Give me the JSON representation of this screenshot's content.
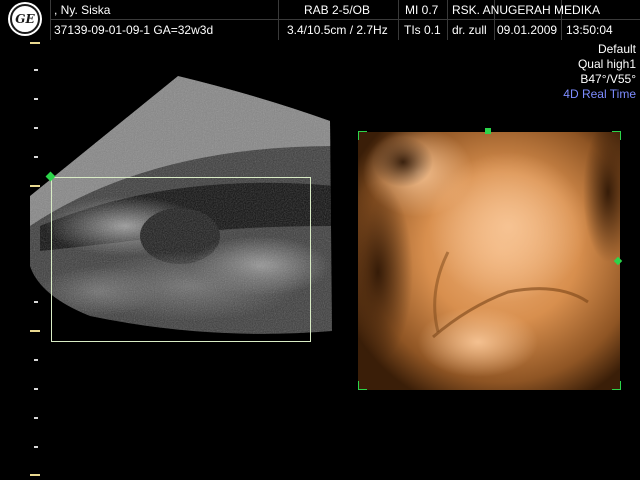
{
  "header": {
    "patient_name": ", Ny. Siska",
    "patient_id_ga": "37139-09-01-09-1  GA=32w3d",
    "probe": "RAB 2-5/OB",
    "depth_freq": "3.4/10.5cm / 2.7Hz",
    "mi": "MI  0.7",
    "tis": "TIs  0.1",
    "hospital": "RSK. ANUGERAH MEDIKA",
    "doctor": "dr. zull",
    "date": "09.01.2009",
    "time": "13:50:04"
  },
  "info_panel": {
    "preset": "Default",
    "quality": "Qual high1",
    "angles": "B47°/V55°",
    "mode": "4D Real Time"
  },
  "colors": {
    "mode_text": "#7d8cff",
    "roi_markers": "#2bd44a",
    "render_tint": "#e8a060"
  },
  "icons": [
    "ge-logo-icon"
  ]
}
